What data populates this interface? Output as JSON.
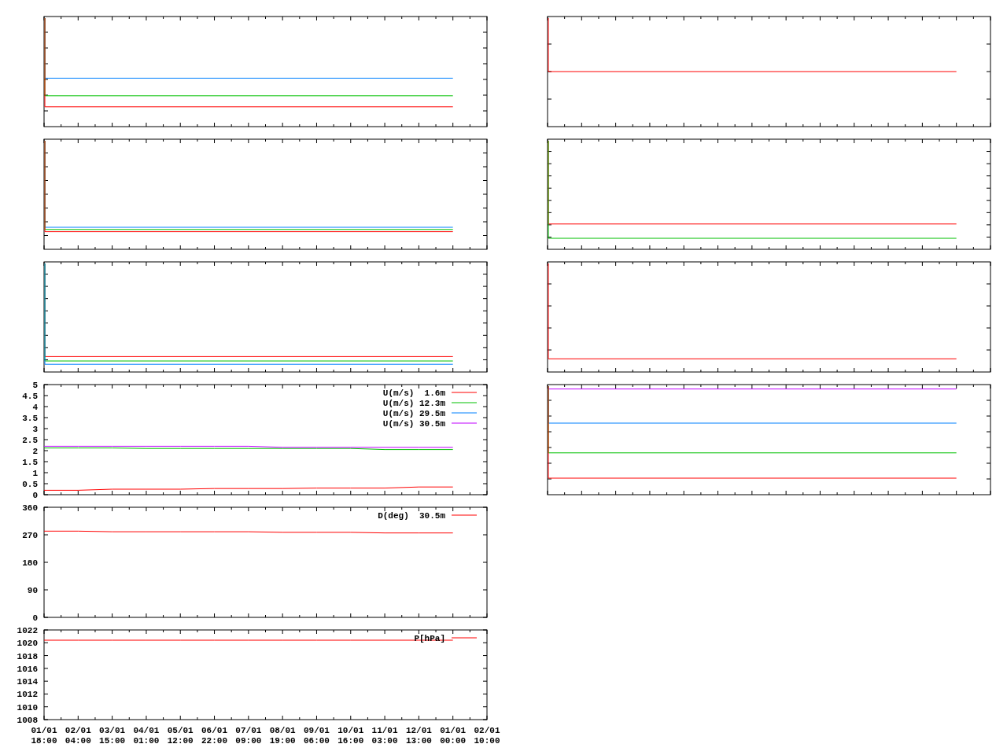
{
  "charts": [
    {
      "chart_data": {
        "type": "line",
        "legend": true,
        "ylim": [
          0,
          5
        ],
        "yticks": [
          {
            "value": 0,
            "label": "0"
          },
          {
            "value": 0.5,
            "label": "0.5"
          },
          {
            "value": 1,
            "label": "1"
          },
          {
            "value": 1.5,
            "label": "1.5"
          },
          {
            "value": 2,
            "label": "2"
          },
          {
            "value": 2.5,
            "label": "2.5"
          },
          {
            "value": 3,
            "label": "3"
          },
          {
            "value": 3.5,
            "label": "3.5"
          },
          {
            "value": 4,
            "label": "4"
          },
          {
            "value": 4.5,
            "label": "4.5"
          },
          {
            "value": 5,
            "label": "5"
          }
        ],
        "categories": [
          null,
          null,
          null,
          null,
          null,
          null,
          null,
          null,
          null,
          null,
          null,
          null,
          null,
          null
        ],
        "series": [
          {
            "name": "U(m/s)  1.6m",
            "color": "#ff0000",
            "values": [
              0.2,
              0.2,
              0.25,
              0.25,
              0.25,
              0.28,
              0.28,
              0.28,
              0.3,
              0.3,
              0.3,
              0.35,
              0.35,
              null
            ]
          },
          {
            "name": "U(m/s) 12.3m",
            "color": "#00c000",
            "values": [
              2.12,
              2.12,
              2.12,
              2.1,
              2.1,
              2.1,
              2.1,
              2.1,
              2.1,
              2.1,
              2.05,
              2.05,
              2.05,
              null
            ]
          },
          {
            "name": "U(m/s) 29.5m",
            "color": "#0080ff",
            "values": [
              null,
              null,
              null,
              null,
              null,
              null,
              null,
              null,
              null,
              null,
              null,
              null,
              null,
              null
            ]
          },
          {
            "name": "U(m/s) 30.5m",
            "color": "#c000ff",
            "values": [
              2.2,
              2.2,
              2.2,
              2.2,
              2.2,
              2.2,
              2.2,
              2.15,
              2.15,
              2.15,
              2.15,
              2.15,
              2.15,
              null
            ]
          }
        ]
      }
    },
    {
      "chart_data": {
        "type": "line",
        "legend": true,
        "ylim": [
          0,
          360
        ],
        "yticks": [
          0,
          90,
          180,
          270,
          360
        ],
        "categories": [
          null,
          null,
          null,
          null,
          null,
          null,
          null,
          null,
          null,
          null,
          null,
          null,
          null,
          null
        ],
        "series": [
          {
            "name": "D(deg)  30.5m",
            "color": "#ff0000",
            "values": [
              282,
              282,
              280,
              280,
              280,
              280,
              280,
              278,
              278,
              278,
              276,
              276,
              276,
              null
            ]
          }
        ]
      }
    },
    {
      "chart_data": {
        "type": "line",
        "legend": true,
        "ylim": [
          1008,
          1022
        ],
        "yticks": [
          1008,
          1010,
          1012,
          1014,
          1016,
          1018,
          1020,
          1022
        ],
        "categories": [
          "01/01\n18:00",
          "02/01\n04:00",
          "03/01\n15:00",
          "04/01\n01:00",
          "05/01\n12:00",
          "06/01\n22:00",
          "07/01\n09:00",
          "08/01\n19:00",
          "09/01\n06:00",
          "10/01\n16:00",
          "11/01\n03:00",
          "12/01\n13:00",
          "01/01\n00:00",
          "02/01\n10:00"
        ],
        "series": [
          {
            "name": "P[hPa]",
            "color": "#ff0000",
            "values": [
              1020.4,
              1020.4,
              1020.4,
              1020.4,
              1020.4,
              1020.4,
              1020.4,
              1020.4,
              1020.4,
              1020.4,
              1020.4,
              1020.4,
              1020.4,
              null
            ]
          }
        ]
      }
    }
  ]
}
